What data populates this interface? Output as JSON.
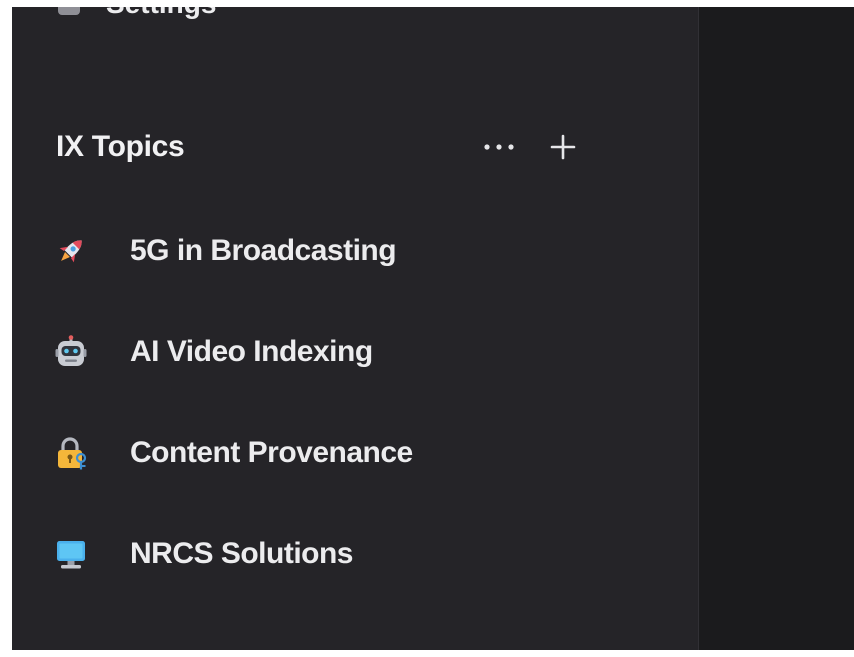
{
  "sidebar": {
    "cutoff_item": {
      "label": "Settings",
      "icon": "gear-icon"
    },
    "section": {
      "title": "IX Topics",
      "more_label": "···",
      "add_label": "+"
    },
    "topics": [
      {
        "label": "5G in Broadcasting",
        "icon": "rocket-icon"
      },
      {
        "label": "AI Video Indexing",
        "icon": "robot-icon"
      },
      {
        "label": "Content Provenance",
        "icon": "lock-with-key-icon"
      },
      {
        "label": "NRCS Solutions",
        "icon": "computer-monitor-icon"
      }
    ]
  },
  "colors": {
    "sidebar_bg": "#252428",
    "main_bg": "#1b1b1d",
    "text": "#ececee"
  }
}
